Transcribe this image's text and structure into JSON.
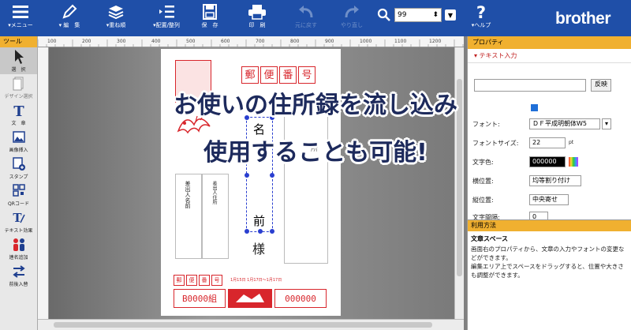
{
  "toolbar": {
    "menu": "▾メニュー",
    "edit": "▾ 編　集",
    "layers": "▾重ね順",
    "align": "▾配置/整列",
    "save": "保　存",
    "print": "印　刷",
    "undo": "元に戻す",
    "redo": "やり直し",
    "zoom_value": "99",
    "help": "▾ヘルプ",
    "brand": "brother"
  },
  "left_panel": {
    "title": "ツール",
    "tools": [
      "選　択",
      "デザイン選択",
      "文　章",
      "画像挿入",
      "スタンプ",
      "QRコード",
      "テキスト効果",
      "連名追加",
      "前後入替"
    ]
  },
  "ruler": {
    "ticks": [
      "100",
      "200",
      "300",
      "400",
      "500",
      "600",
      "700",
      "800",
      "900",
      "1000",
      "1100",
      "1200"
    ]
  },
  "postcard": {
    "postal_labels": [
      "郵",
      "便",
      "番",
      "号"
    ],
    "address_placeholder": "所",
    "name_chars": [
      "名",
      "前"
    ],
    "honorific": "様",
    "sender_name": "差出人名前",
    "sender_address": "差出人住所",
    "lottery_labels": [
      "郵",
      "便",
      "番",
      "号"
    ],
    "lottery_note": "1月15日 1月17日～1月17日",
    "bottom_left": "B0000組",
    "bottom_right": "000000"
  },
  "headline": {
    "line1": "お使いの住所録を流し込み",
    "line2": "使用することも可能!"
  },
  "right_panel": {
    "title": "プロパティ",
    "section": "▾ テキスト入力",
    "reverse_button": "反映",
    "font_label": "フォント:",
    "font_value": "ＤＦ平成明朝体W5",
    "font_size_label": "フォントサイズ:",
    "font_size_value": "22",
    "font_size_unit": "pt",
    "color_label": "文字色:",
    "color_value": "000000",
    "h_align_label": "横位置:",
    "h_align_value": "均等割り付け",
    "v_align_label": "縦位置:",
    "v_align_value": "中央寄せ",
    "spacing_label": "文字間隔:",
    "spacing_value": "0"
  },
  "usage": {
    "title": "利用方法",
    "heading": "文章スペース",
    "body1": "画面右のプロパティから、文章の入力やフォントの変更などができます。",
    "body2": "編集エリア上でスペースをドラッグすると、位置や大きさも調整ができます。"
  },
  "colors": {
    "toolbar_bg": "#1f4fa8",
    "accent": "#f0b030",
    "postcard_red": "#d8262c",
    "headline": "#1d2a5c"
  }
}
